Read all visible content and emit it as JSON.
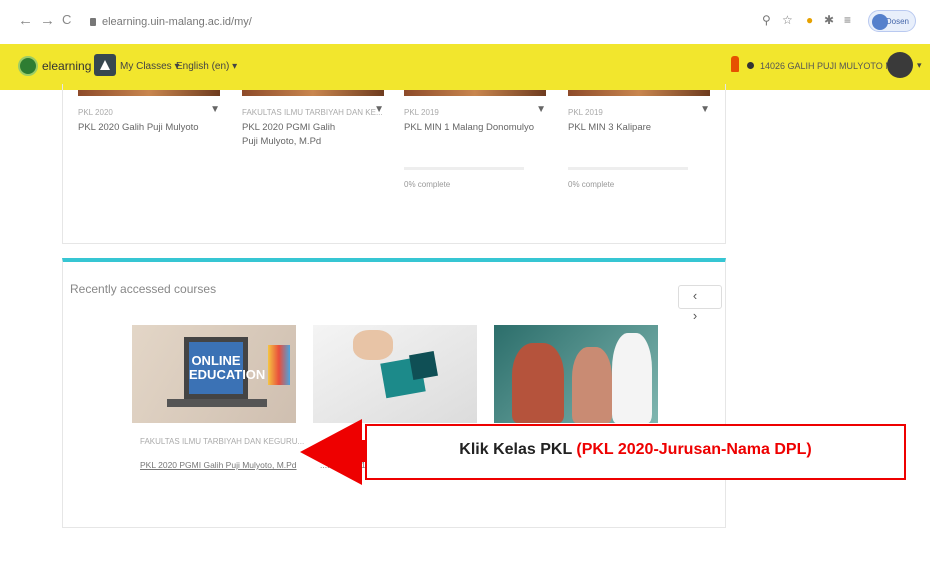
{
  "browser": {
    "url": "elearning.uin-malang.ac.id/my/",
    "profile_label": "Dosen",
    "nav": {
      "back": "←",
      "forward": "→",
      "reload": "C"
    }
  },
  "header": {
    "site_name": "elearning",
    "my_classes": "My Classes ▾",
    "language": "English (en) ▾",
    "username": "14026 GALIH PUJI MULYOTO M.Pd",
    "colors": {
      "bar": "#f2e62d",
      "accent": "#36c6d3"
    }
  },
  "course_cards": [
    {
      "category": "PKL 2020",
      "title": "PKL 2020 Galih Puji Mulyoto",
      "progress": ""
    },
    {
      "category": "FAKULTAS ILMU TARBIYAH DAN KE...",
      "title": "PKL 2020 PGMI Galih Puji Mulyoto, M.Pd",
      "progress": ""
    },
    {
      "category": "PKL 2019",
      "title": "PKL MIN 1 Malang Donomulyo",
      "progress": "0% complete"
    },
    {
      "category": "PKL 2019",
      "title": "PKL MIN 3 Kalipare",
      "progress": "0% complete"
    }
  ],
  "recent": {
    "title": "Recently accessed courses",
    "pager": "‹ ›",
    "courses": [
      {
        "thumb_text": "ONLINE EDUCATION",
        "category": "FAKULTAS ILMU TARBIYAH DAN KEGURU...",
        "title": "PKL 2020 PGMI Galih Puji Mulyoto, M.Pd"
      },
      {
        "title": "...IKAN MI 1"
      }
    ]
  },
  "callout": {
    "prefix": "Klik Kelas PKL ",
    "highlight": "(PKL 2020-Jurusan-Nama DPL)"
  }
}
